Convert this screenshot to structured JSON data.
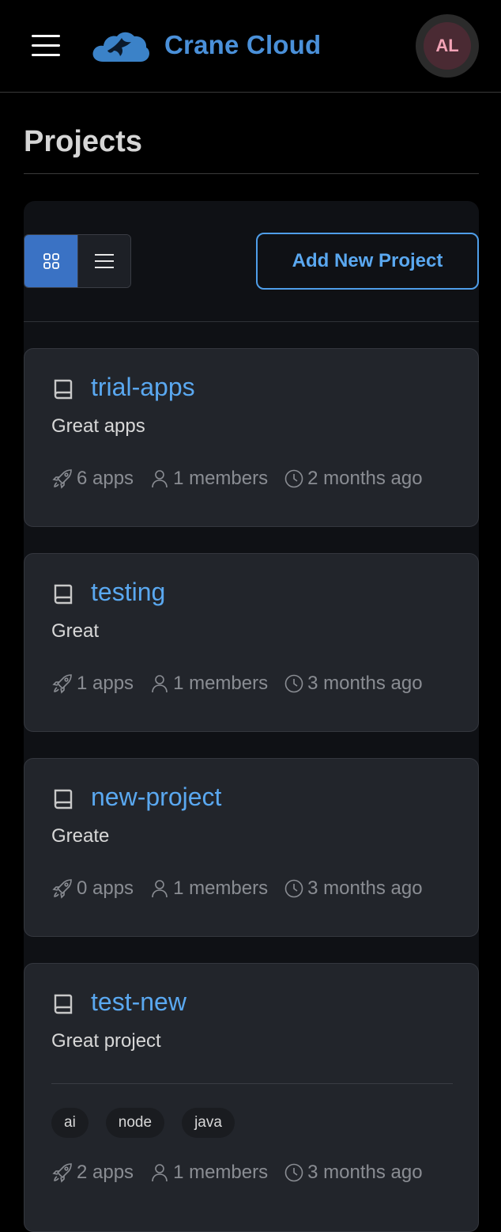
{
  "header": {
    "brand": "Crane Cloud",
    "avatar_initials": "AL",
    "menu_icon": "hamburger-menu-icon",
    "logo_icon": "crane-cloud-logo"
  },
  "page": {
    "title": "Projects"
  },
  "toolbar": {
    "grid_view_icon": "grid-view-icon",
    "list_view_icon": "list-view-icon",
    "active_view": "grid",
    "add_button_label": "Add New Project"
  },
  "projects": [
    {
      "name": "trial-apps",
      "description": "Great apps",
      "apps": "6 apps",
      "members": "1 members",
      "updated": "2 months ago",
      "tags": []
    },
    {
      "name": "testing",
      "description": "Great",
      "apps": "1 apps",
      "members": "1 members",
      "updated": "3 months ago",
      "tags": []
    },
    {
      "name": "new-project",
      "description": "Greate",
      "apps": "0 apps",
      "members": "1 members",
      "updated": "3 months ago",
      "tags": []
    },
    {
      "name": "test-new",
      "description": "Great project",
      "apps": "2 apps",
      "members": "1 members",
      "updated": "3 months ago",
      "tags": [
        "ai",
        "node",
        "java"
      ]
    }
  ],
  "colors": {
    "accent": "#4a90d9",
    "link": "#5aa8f0",
    "grid_active": "#3a72c4",
    "card_bg": "#22252b",
    "avatar_bg": "#4a2a33",
    "avatar_text": "#f2a3b6"
  }
}
